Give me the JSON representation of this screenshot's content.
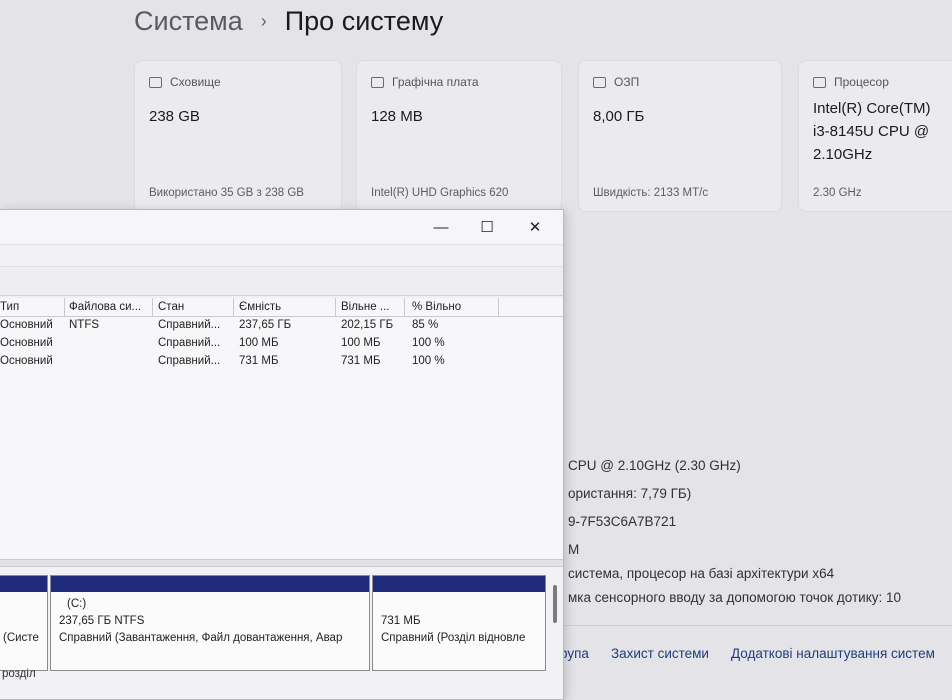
{
  "breadcrumb": {
    "parent": "Система",
    "separator": "›",
    "current": "Про систему"
  },
  "cards": [
    {
      "title": "Сховище",
      "icon": "storage-icon",
      "value": "238 GB",
      "sub": "Використано 35 GB з 238 GB"
    },
    {
      "title": "Графічна плата",
      "icon": "display-adapter-icon",
      "value": "128 MB",
      "sub": "Intel(R) UHD Graphics 620"
    },
    {
      "title": "ОЗП",
      "icon": "ram-icon",
      "value": "8,00 ГБ",
      "sub": "Швидкість: 2133 MT/c"
    },
    {
      "title": "Процесор",
      "icon": "cpu-icon",
      "value_lines": [
        "Intel(R) Core(TM)",
        "i3-8145U CPU @",
        "2.10GHz"
      ],
      "sub": "2.30 GHz"
    }
  ],
  "specs": [
    "CPU @ 2.10GHz (2.30 GHz)",
    "ористання: 7,79 ГБ)",
    "9-7F53C6A7B721",
    "M",
    "система, процесор на базі архітектури x64",
    "мка сенсорного вводу за допомогою точок дотику: 10"
  ],
  "links": [
    "рупа",
    "Захист системи",
    "Додаткові налаштування систем"
  ],
  "window": {
    "controls": {
      "minimize": "—",
      "maximize": "☐",
      "close": "✕"
    },
    "columns": [
      "Тип",
      "Файлова си...",
      "Стан",
      "Ємність",
      "Вільне ...",
      "% Вільно"
    ],
    "rows": [
      [
        "Основний",
        "NTFS",
        "Справний...",
        "237,65 ГБ",
        "202,15 ГБ",
        "85 %"
      ],
      [
        "Основний",
        "",
        "Справний...",
        "100 МБ",
        "100 МБ",
        "100 %"
      ],
      [
        "Основний",
        "",
        "Справний...",
        "731 МБ",
        "731 МБ",
        "100 %"
      ]
    ],
    "partitions": [
      {
        "lines": [
          "",
          "",
          "(Систе"
        ]
      },
      {
        "lines": [
          "(C:)",
          "237,65 ГБ NTFS",
          "Справний (Завантаження, Файл довантаження, Авар"
        ]
      },
      {
        "lines": [
          "",
          "731 МБ",
          "Справний (Розділ відновле"
        ]
      }
    ],
    "legend": "розділ"
  }
}
